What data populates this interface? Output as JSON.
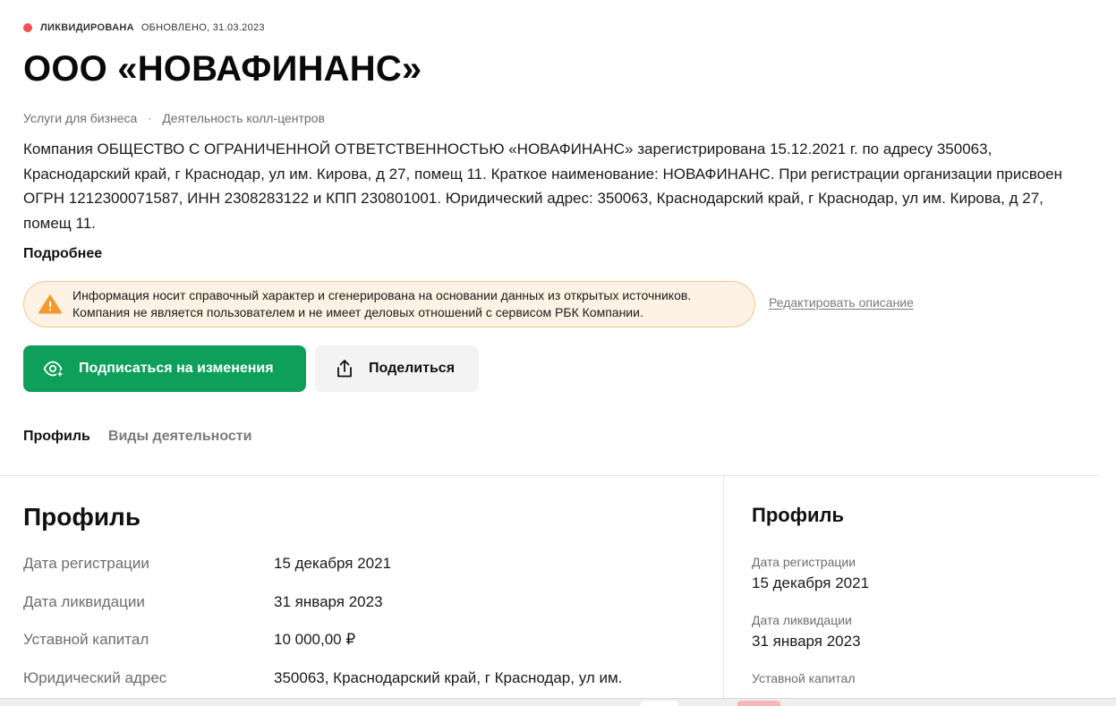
{
  "status": {
    "label": "ЛИКВИДИРОВАНА",
    "updated": "ОБНОВЛЕНО, 31.03.2023",
    "dot_color": "#f0504f"
  },
  "company": {
    "title": "ООО «НОВАФИНАНС»"
  },
  "breadcrumb": {
    "items": [
      "Услуги для бизнеса",
      "Деятельность колл-центров"
    ],
    "separator": "·"
  },
  "description": {
    "text": "Компания ОБЩЕСТВО С ОГРАНИЧЕННОЙ ОТВЕТСТВЕННОСТЬЮ «НОВАФИНАНС» зарегистрирована 15.12.2021 г. по адресу 350063, Краснодарский край, г Краснодар, ул им. Кирова, д 27, помещ 11. Краткое наименование: НОВАФИНАНС. При регистрации организации присвоен ОГРН 1212300071587, ИНН 2308283122 и КПП 230801001. Юридический адрес: 350063, Краснодарский край, г Краснодар, ул им. Кирова, д 27, помещ 11.",
    "more_label": "Подробнее"
  },
  "notice": {
    "icon": "warning-icon",
    "line1": "Информация носит справочный характер и сгенерирована на основании данных из открытых источников.",
    "line2": "Компания не является пользователем и не имеет деловых отношений с сервисом РБК Компании.",
    "edit_label": "Редактировать описание"
  },
  "actions": {
    "subscribe_label": "Подписаться на изменения",
    "subscribe_icon": "eye-plus-icon",
    "share_label": "Поделиться",
    "share_icon": "share-icon",
    "accent_color": "#0e9f5a"
  },
  "tabs": [
    {
      "label": "Профиль",
      "active": true
    },
    {
      "label": "Виды деятельности",
      "active": false
    }
  ],
  "profile": {
    "heading": "Профиль",
    "rows": [
      {
        "label": "Дата регистрации",
        "value": "15 декабря 2021"
      },
      {
        "label": "Дата ликвидации",
        "value": "31 января 2023"
      },
      {
        "label": "Уставной капитал",
        "value": "10 000,00 ₽"
      },
      {
        "label": "Юридический адрес",
        "value": "350063, Краснодарский край, г Краснодар, ул им."
      }
    ]
  },
  "sidebar": {
    "heading": "Профиль",
    "items": [
      {
        "label": "Дата регистрации",
        "value": "15 декабря 2021"
      },
      {
        "label": "Дата ликвидации",
        "value": "31 января 2023"
      },
      {
        "label": "Уставной капитал",
        "value": ""
      }
    ]
  }
}
